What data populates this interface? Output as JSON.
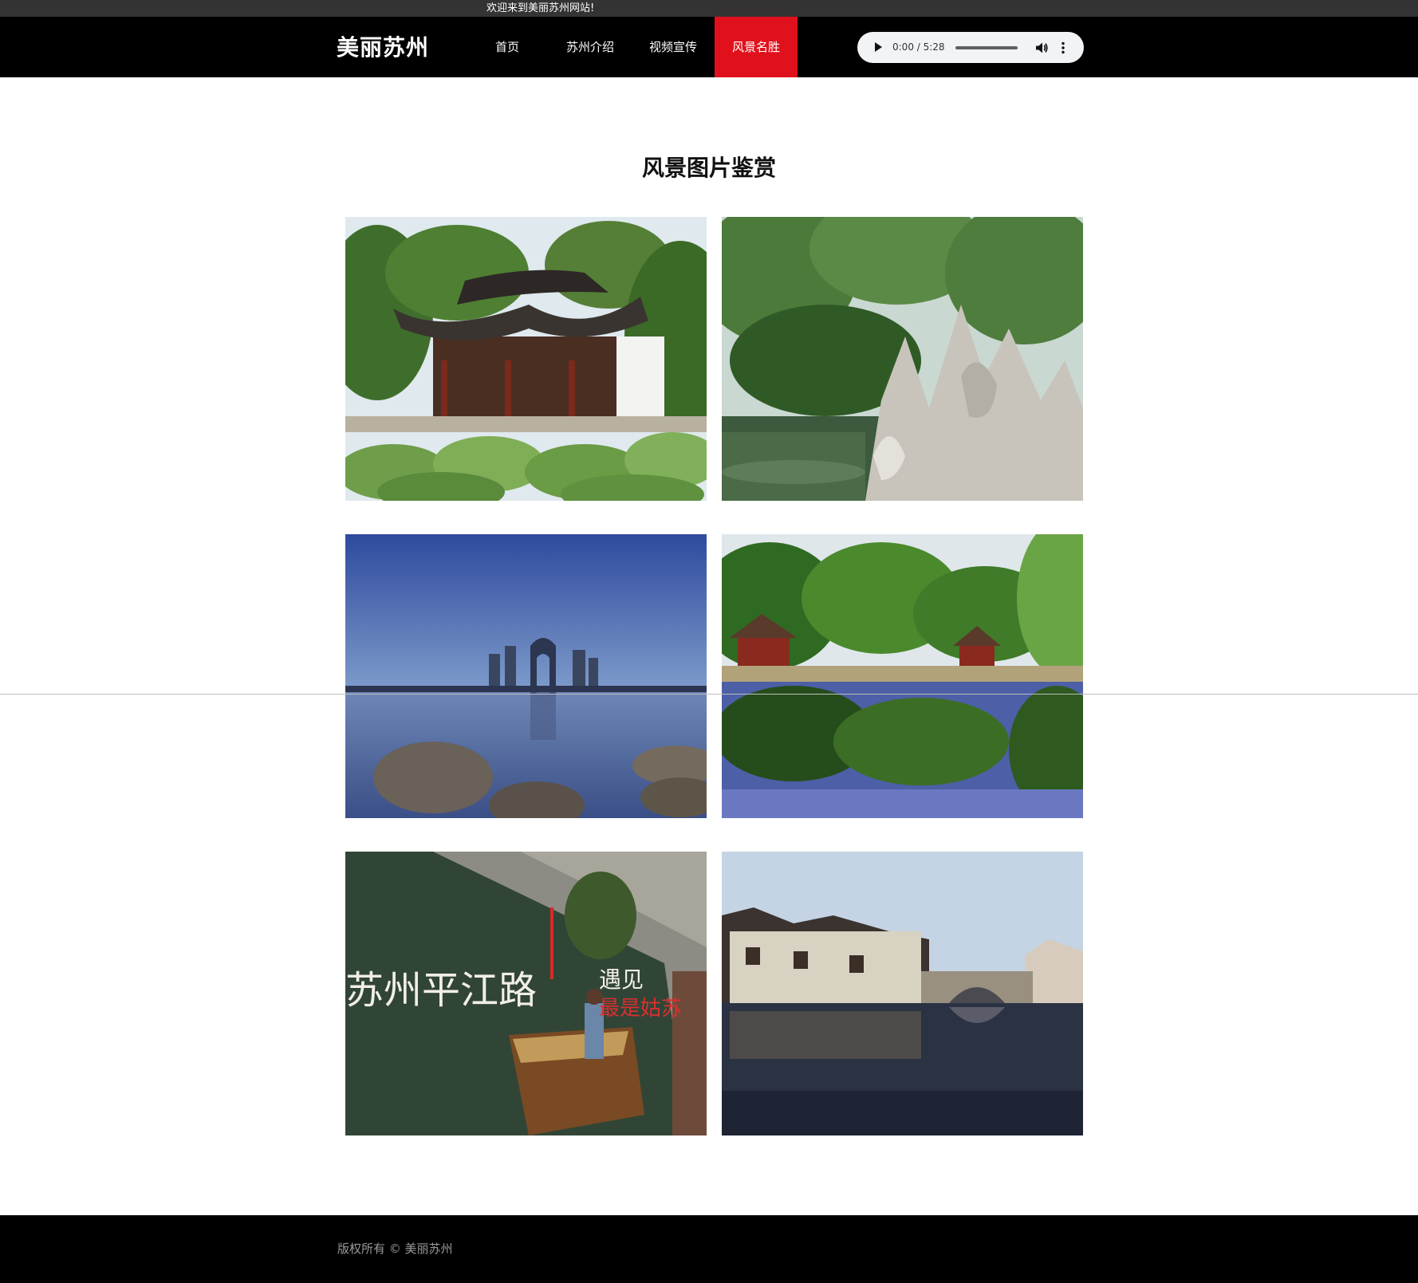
{
  "topbar": {
    "welcome": "欢迎来到美丽苏州网站!"
  },
  "header": {
    "logo": "美丽苏州",
    "nav": [
      {
        "label": "首页",
        "active": false
      },
      {
        "label": "苏州介绍",
        "active": false
      },
      {
        "label": "视频宣传",
        "active": false
      },
      {
        "label": "风景名胜",
        "active": true
      }
    ],
    "accent_color": "#e0111c"
  },
  "audio": {
    "time": "0:00 / 5:28",
    "progress": 0
  },
  "main": {
    "title": "风景图片鉴赏",
    "photos": [
      {
        "icon": "garden-pavilion-lotus-photo"
      },
      {
        "icon": "rockery-pond-photo"
      },
      {
        "icon": "lake-skyline-dusk-photo"
      },
      {
        "icon": "pavilion-reflection-photo"
      },
      {
        "icon": "pingjiang-road-boat-photo",
        "overlay_text": "苏州平江路",
        "overlay_text_2": "遇见",
        "overlay_text_3": "最是姑苏"
      },
      {
        "icon": "water-town-bridge-photo"
      }
    ]
  },
  "footer": {
    "copyright": "版权所有 © 美丽苏州"
  }
}
